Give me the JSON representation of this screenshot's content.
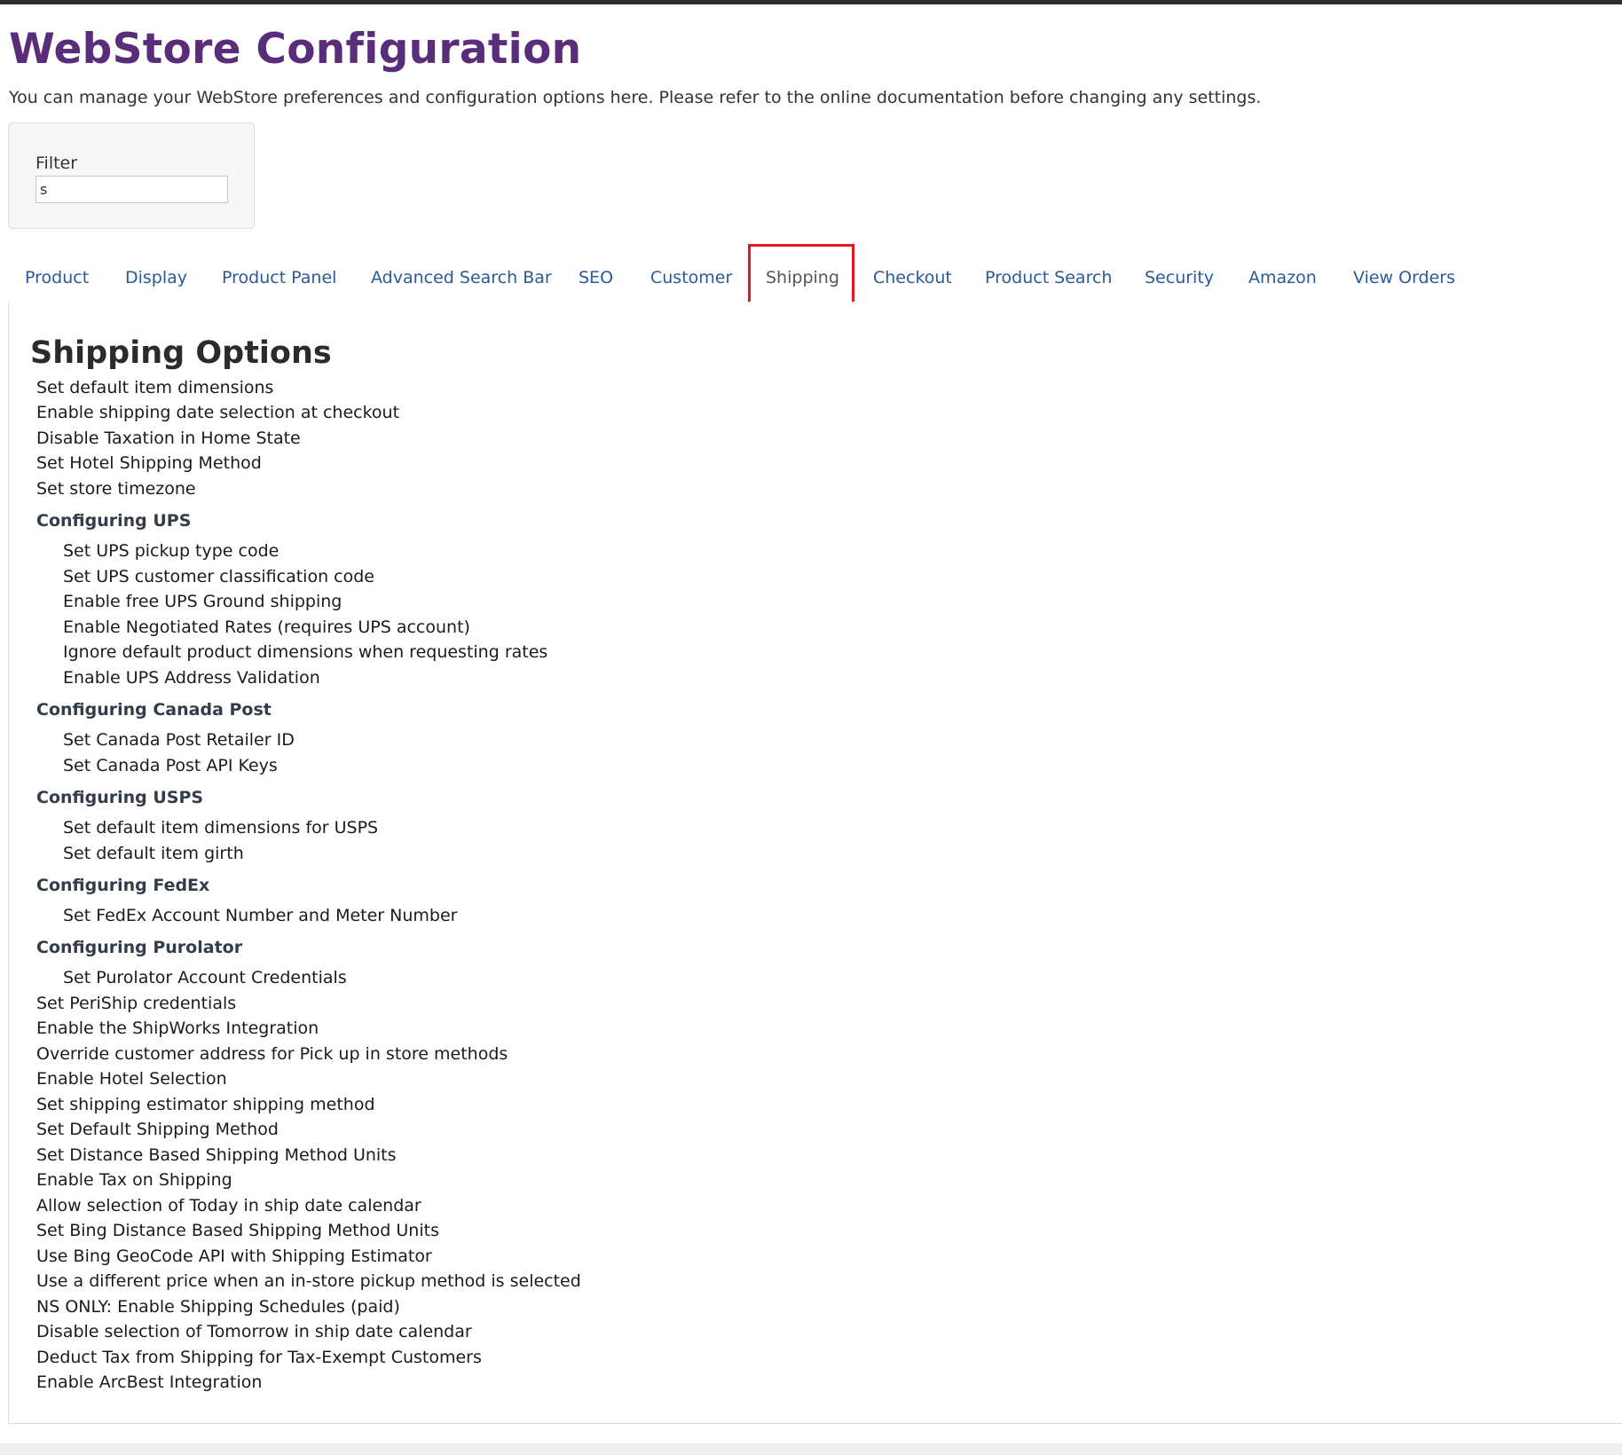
{
  "header": {
    "title": "WebStore Configuration",
    "description": "You can manage your WebStore preferences and configuration options here. Please refer to the online documentation before changing any settings."
  },
  "filter": {
    "label": "Filter",
    "value": "s"
  },
  "tabs": [
    {
      "label": "Product"
    },
    {
      "label": "Display"
    },
    {
      "label": "Product Panel"
    },
    {
      "label": "Advanced Search Bar"
    },
    {
      "label": "SEO"
    },
    {
      "label": "Customer"
    },
    {
      "label": "Shipping"
    },
    {
      "label": "Checkout"
    },
    {
      "label": "Product Search"
    },
    {
      "label": "Security"
    },
    {
      "label": "Amazon"
    },
    {
      "label": "View Orders"
    }
  ],
  "active_tab": "Shipping",
  "highlight_color": "#e3171e",
  "title_color": "#5a2d7a",
  "link_color": "#2a5a9a",
  "content": {
    "title": "Shipping Options",
    "general_items": [
      "Set default item dimensions",
      "Enable shipping date selection at checkout",
      "Disable Taxation in Home State",
      "Set Hotel Shipping Method",
      "Set store timezone"
    ],
    "ups": {
      "heading": "Configuring UPS",
      "items": [
        "Set UPS pickup type code",
        "Set UPS customer classification code",
        "Enable free UPS Ground shipping",
        "Enable Negotiated Rates (requires UPS account)",
        "Ignore default product dimensions when requesting rates",
        "Enable UPS Address Validation"
      ]
    },
    "canada_post": {
      "heading": "Configuring Canada Post",
      "items": [
        "Set Canada Post Retailer ID",
        "Set Canada Post API Keys"
      ]
    },
    "usps": {
      "heading": "Configuring USPS",
      "items": [
        "Set default item dimensions for USPS",
        "Set default item girth"
      ]
    },
    "fedex": {
      "heading": "Configuring FedEx",
      "items": [
        "Set FedEx Account Number and Meter Number"
      ]
    },
    "purolator": {
      "heading": "Configuring Purolator",
      "items": [
        "Set Purolator Account Credentials"
      ]
    },
    "other_items": [
      "Set PeriShip credentials",
      "Enable the ShipWorks Integration",
      "Override customer address for Pick up in store methods",
      "Enable Hotel Selection",
      "Set shipping estimator shipping method",
      "Set Default Shipping Method",
      "Set Distance Based Shipping Method Units",
      "Enable Tax on Shipping",
      "Allow selection of Today in ship date calendar",
      "Set Bing Distance Based Shipping Method Units",
      "Use Bing GeoCode API with Shipping Estimator",
      "Use a different price when an in-store pickup method is selected",
      "NS ONLY: Enable Shipping Schedules (paid)",
      "Disable selection of Tomorrow in ship date calendar",
      "Deduct Tax from Shipping for Tax-Exempt Customers",
      "Enable ArcBest Integration"
    ]
  }
}
